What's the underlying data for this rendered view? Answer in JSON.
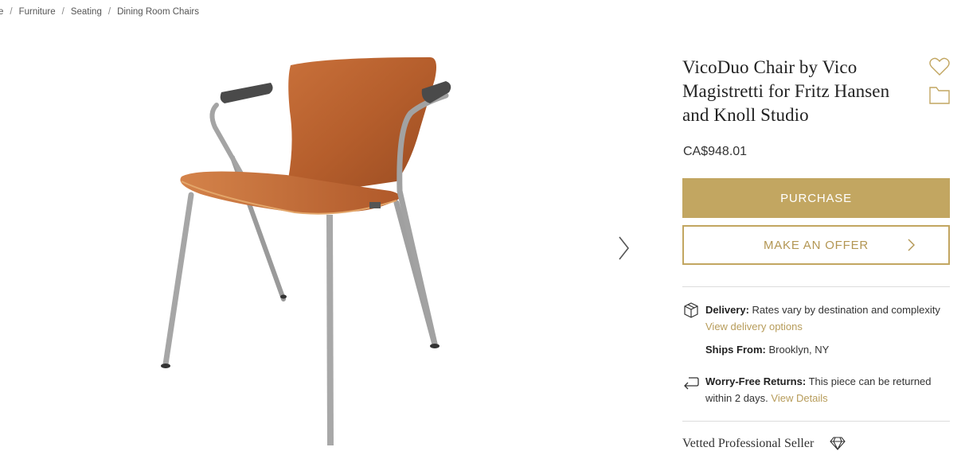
{
  "breadcrumb": {
    "items": [
      "e",
      "Furniture",
      "Seating",
      "Dining Room Chairs"
    ],
    "separator": "/"
  },
  "product": {
    "title": "VicoDuo Chair by Vico Magistretti for Fritz Hansen and Knoll Studio",
    "price": "CA$948.01",
    "image_alt": "VicoDuo chair with teak plywood shell and steel frame"
  },
  "actions": {
    "purchase_label": "PURCHASE",
    "offer_label": "MAKE AN OFFER"
  },
  "delivery": {
    "label": "Delivery:",
    "text": "Rates vary by destination and complexity",
    "link": "View delivery options"
  },
  "ships_from": {
    "label": "Ships From:",
    "text": "Brooklyn, NY"
  },
  "returns": {
    "label": "Worry-Free Returns:",
    "text": "This piece can be returned within 2 days.",
    "link": "View Details"
  },
  "seller": {
    "label": "Vetted Professional Seller"
  },
  "colors": {
    "accent": "#c2a661",
    "accent_text": "#b79c5a",
    "divider": "#dcdcdc"
  },
  "icons": [
    "heart-icon",
    "folder-icon",
    "chevron-right-icon",
    "box-icon",
    "return-arrow-icon",
    "diamond-icon"
  ]
}
